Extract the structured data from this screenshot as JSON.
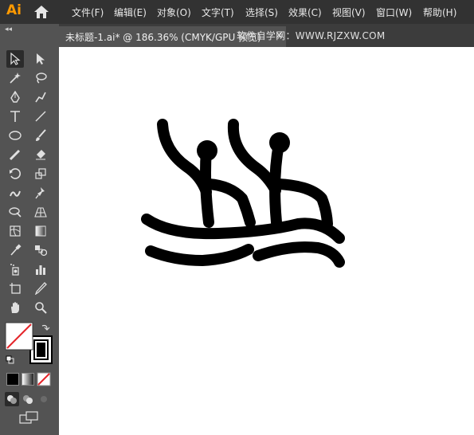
{
  "app": {
    "logo": "Ai"
  },
  "menu": [
    "文件(F)",
    "编辑(E)",
    "对象(O)",
    "文字(T)",
    "选择(S)",
    "效果(C)",
    "视图(V)",
    "窗口(W)",
    "帮助(H)"
  ],
  "document_tab": {
    "title": "未标题-1.ai* @ 186.36% (CMYK/GPU 预览)",
    "close": "×"
  },
  "watermark": "软件自学网：WWW.RJZXW.COM",
  "toolbar": {
    "collapse": "◂◂"
  },
  "tools": [
    "selection-tool",
    "direct-selection-tool",
    "magic-wand-tool",
    "lasso-tool",
    "pen-tool",
    "curvature-tool",
    "type-tool",
    "line-segment-tool",
    "ellipse-tool",
    "paintbrush-tool",
    "shaper-tool",
    "eraser-tool",
    "rotate-tool",
    "scale-tool",
    "warp-tool",
    "puppet-warp-tool",
    "shape-builder-tool",
    "perspective-grid-tool",
    "mesh-tool",
    "gradient-tool",
    "eyedropper-tool",
    "blend-tool",
    "symbol-sprayer-tool",
    "column-graph-tool",
    "artboard-tool",
    "slice-tool",
    "hand-tool",
    "zoom-tool"
  ],
  "colors": {
    "menubar": "#323232",
    "panel": "#535353",
    "canvas": "#ffffff",
    "logo": "#ff9a00",
    "stroke": "#000000"
  }
}
